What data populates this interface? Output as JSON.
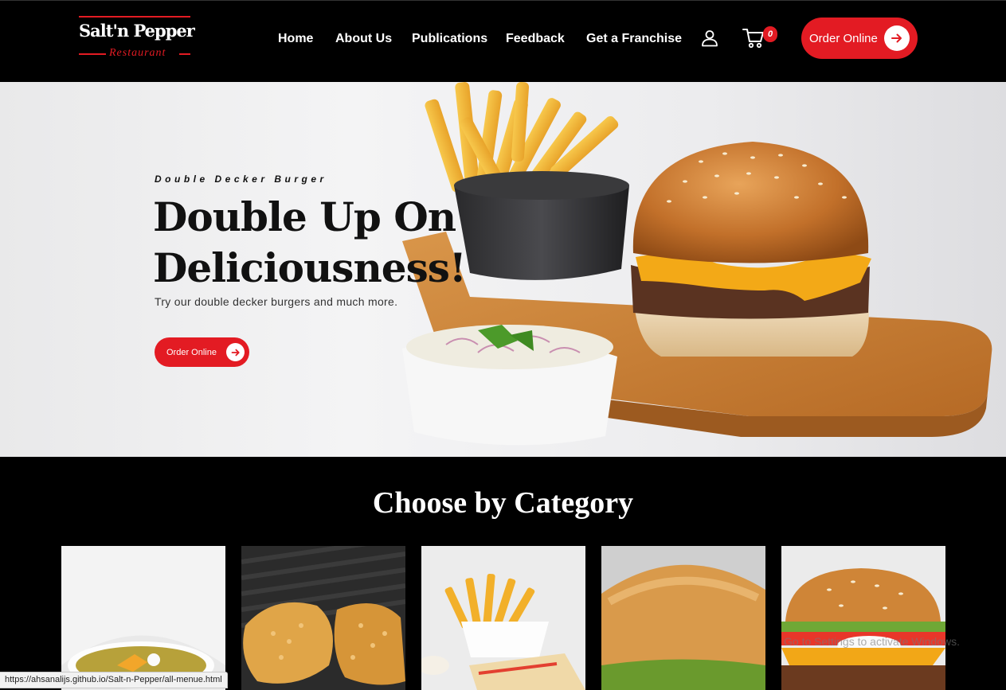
{
  "brand": {
    "name": "Salt'n Pepper",
    "subtitle": "Restaurant",
    "accent_color": "#e31b23"
  },
  "nav": {
    "items": [
      {
        "label": "Home"
      },
      {
        "label": "About Us"
      },
      {
        "label": "Publications"
      },
      {
        "label": "Feedback"
      },
      {
        "label": "Get a Franchise"
      }
    ],
    "user_icon": "user-icon",
    "cart_icon": "cart-icon",
    "cart_count": "0",
    "order_button": "Order Online"
  },
  "hero": {
    "eyebrow": "Double Decker Burger",
    "title_line1": "Double Up On",
    "title_line2": "Deliciousness!",
    "subtitle": "Try our double decker burgers and much more.",
    "cta": "Order Online"
  },
  "categories": {
    "title": "Choose by Category",
    "cards": [
      {
        "image": "soup"
      },
      {
        "image": "fried-chicken"
      },
      {
        "image": "fries-and-sandwich"
      },
      {
        "image": "bun"
      },
      {
        "image": "burger"
      }
    ]
  },
  "browser": {
    "status_url": "https://ahsanalijs.github.io/Salt-n-Pepper/all-menue.html",
    "watermark": "Go to Settings to activate Windows."
  }
}
